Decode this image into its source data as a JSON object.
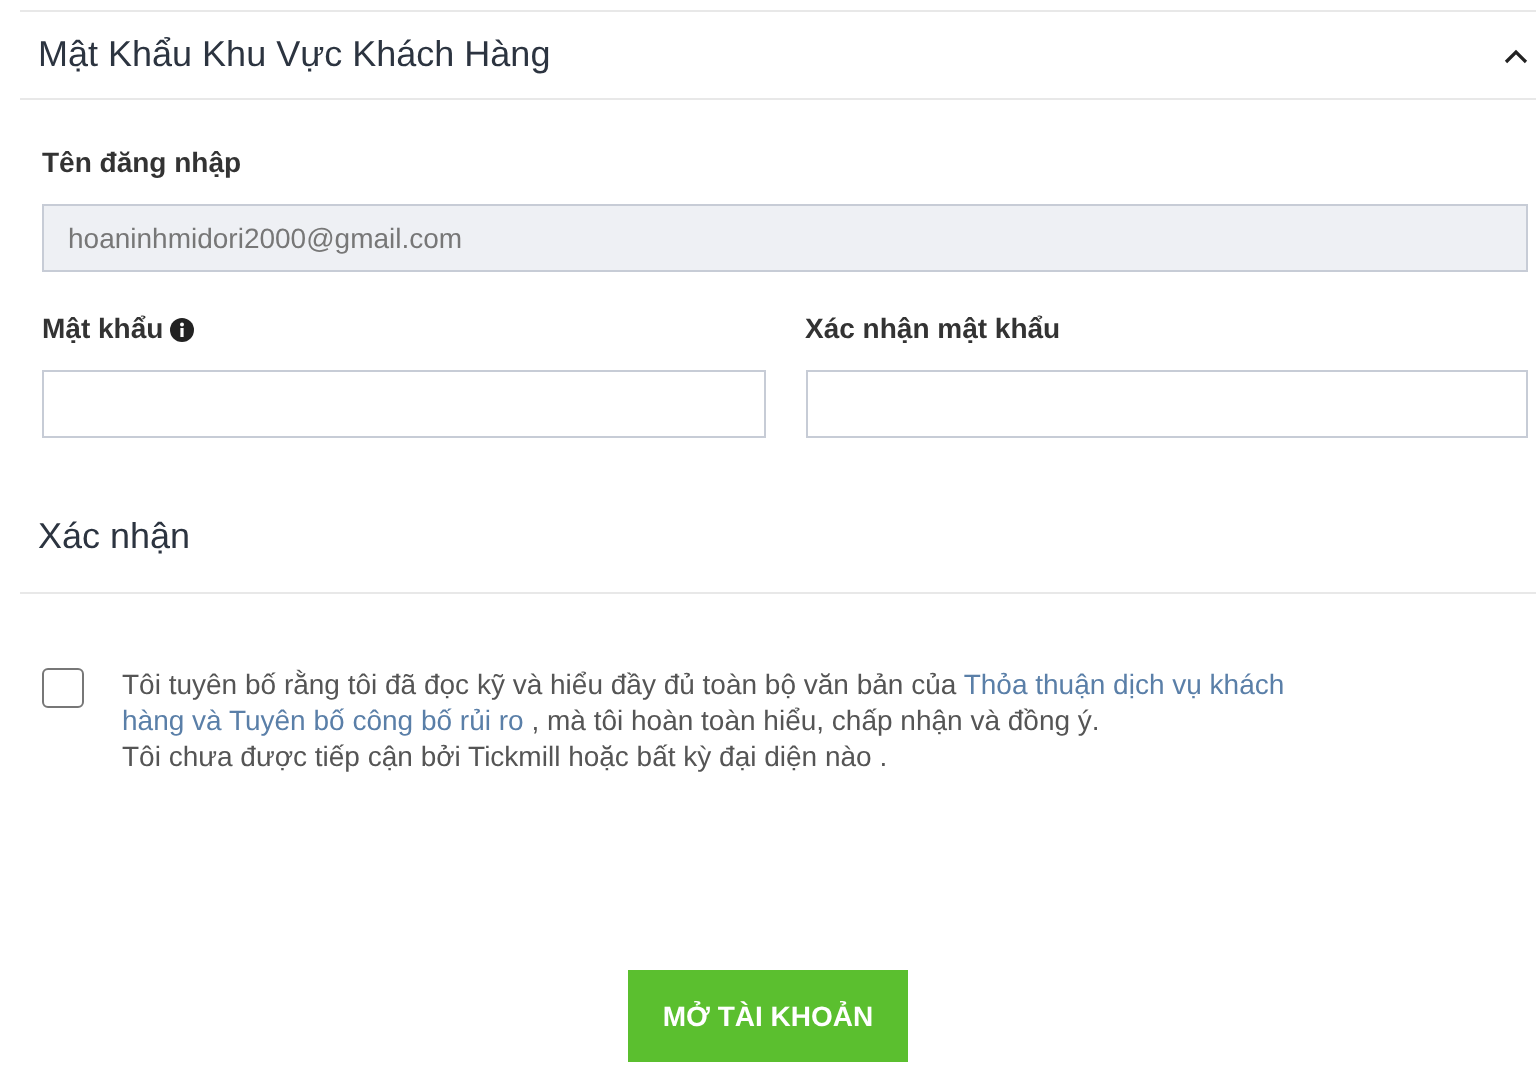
{
  "section": {
    "title": "Mật Khẩu Khu Vực Khách Hàng",
    "expanded": true
  },
  "username": {
    "label": "Tên đăng nhập",
    "value": "hoaninhmidori2000@gmail.com",
    "disabled": true
  },
  "password": {
    "label": "Mật khẩu",
    "placeholder_info": true
  },
  "confirm_password": {
    "label": "Xác nhận mật khẩu"
  },
  "confirmation": {
    "title": "Xác nhận",
    "checked": false,
    "lines": [
      [
        {
          "kind": "text",
          "text": "Tôi tuyên bố rằng tôi đã đọc kỹ và hiểu đầy đủ toàn bộ văn bản của "
        },
        {
          "kind": "link",
          "text": "Thỏa thuận dịch vụ khách"
        }
      ],
      [
        {
          "kind": "link",
          "text": "hàng và Tuyên bố công bố rủi ro"
        },
        {
          "kind": "text",
          "text": " , mà tôi hoàn toàn hiểu, chấp nhận và đồng ý."
        }
      ],
      [
        {
          "kind": "text",
          "text": "Tôi chưa được tiếp cận bởi Tickmill hoặc bất kỳ đại diện nào ."
        }
      ]
    ]
  },
  "submit": {
    "label": "MỞ TÀI KHOẢN"
  }
}
